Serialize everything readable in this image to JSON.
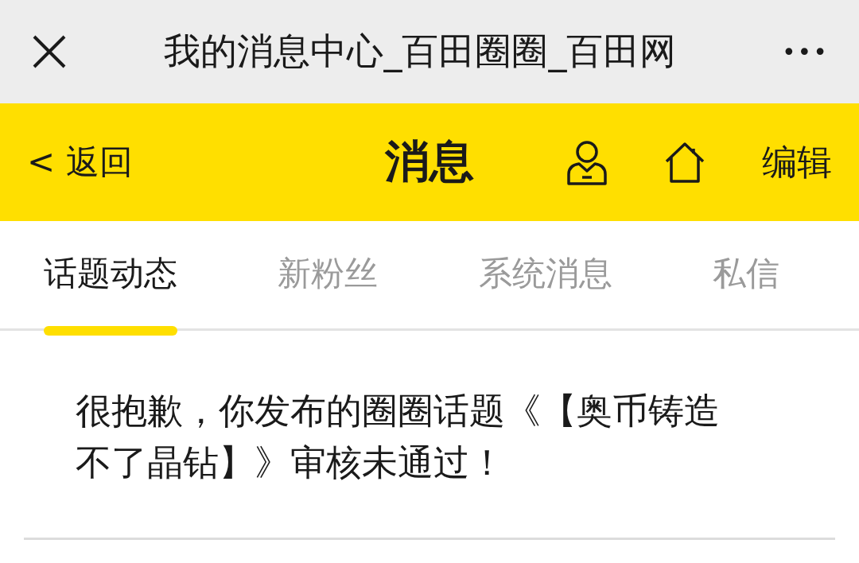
{
  "window": {
    "title": "我的消息中心_百田圈圈_百田网",
    "more": "•••"
  },
  "header": {
    "back": "< 返回",
    "title": "消息",
    "edit": "编辑"
  },
  "tabs": [
    {
      "label": "话题动态",
      "selected": true
    },
    {
      "label": "新粉丝",
      "selected": false
    },
    {
      "label": "系统消息",
      "selected": false
    },
    {
      "label": "私信",
      "selected": false
    }
  ],
  "messages": [
    {
      "text": "很抱歉，你发布的圈圈话题《【奥币铸造不了晶钻】》审核未通过！"
    }
  ]
}
